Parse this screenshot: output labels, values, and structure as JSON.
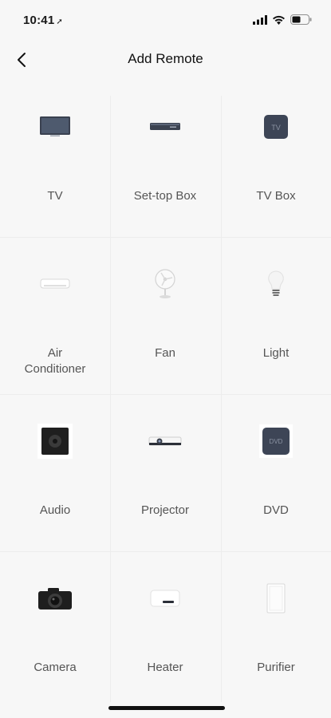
{
  "status_bar": {
    "time": "10:41",
    "location_glyph": "➚"
  },
  "header": {
    "title": "Add Remote"
  },
  "devices": [
    {
      "label": "TV",
      "icon": "tv-icon"
    },
    {
      "label": "Set-top Box",
      "icon": "set-top-box-icon"
    },
    {
      "label": "TV Box",
      "icon": "tv-box-icon",
      "icon_text": "TV"
    },
    {
      "label": "Air Conditioner",
      "icon": "air-conditioner-icon"
    },
    {
      "label": "Fan",
      "icon": "fan-icon"
    },
    {
      "label": "Light",
      "icon": "light-bulb-icon"
    },
    {
      "label": "Audio",
      "icon": "speaker-icon"
    },
    {
      "label": "Projector",
      "icon": "projector-icon"
    },
    {
      "label": "DVD",
      "icon": "dvd-icon",
      "icon_text": "DVD"
    },
    {
      "label": "Camera",
      "icon": "camera-icon"
    },
    {
      "label": "Heater",
      "icon": "heater-icon"
    },
    {
      "label": "Purifier",
      "icon": "purifier-icon"
    }
  ]
}
